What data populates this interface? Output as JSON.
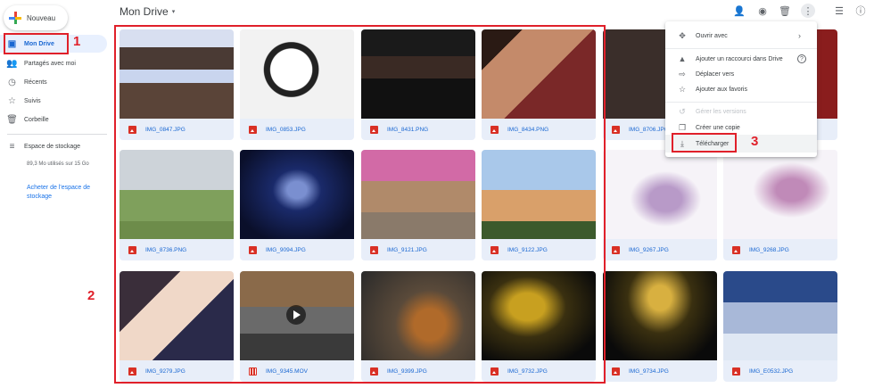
{
  "sidebar": {
    "new_label": "Nouveau",
    "items": [
      {
        "label": "Mon Drive",
        "icon": "my-drive-icon",
        "glyph": "▣"
      },
      {
        "label": "Partagés avec moi",
        "icon": "shared-icon",
        "glyph": "👥"
      },
      {
        "label": "Récents",
        "icon": "clock-icon",
        "glyph": "◷"
      },
      {
        "label": "Suivis",
        "icon": "star-icon",
        "glyph": "☆"
      },
      {
        "label": "Corbeille",
        "icon": "trash-icon",
        "glyph": "🗑"
      }
    ],
    "storage_label": "Espace de stockage",
    "storage_icon": "storage-icon",
    "storage_used": "89,3 Mo utilisés sur 15 Go",
    "buy_storage": "Acheter de l'espace de stockage"
  },
  "header": {
    "title": "Mon Drive",
    "caret": "▾",
    "icons": [
      {
        "name": "add-person-icon",
        "glyph": "👤"
      },
      {
        "name": "eye-icon",
        "glyph": "◉"
      },
      {
        "name": "trash-icon",
        "glyph": "🗑"
      },
      {
        "name": "more-vert-icon",
        "glyph": "⋮"
      },
      {
        "name": "list-view-icon",
        "glyph": "☰"
      },
      {
        "name": "info-icon",
        "glyph": "ⓘ"
      }
    ]
  },
  "files": [
    {
      "name": "IMG_0847.JPG",
      "type": "image"
    },
    {
      "name": "IMG_0853.JPG",
      "type": "image"
    },
    {
      "name": "IMG_8431.PNG",
      "type": "image"
    },
    {
      "name": "IMG_8434.PNG",
      "type": "image"
    },
    {
      "name": "IMG_8706.JPG",
      "type": "image"
    },
    {
      "name": "",
      "type": "image"
    },
    {
      "name": "IMG_8736.PNG",
      "type": "image"
    },
    {
      "name": "IMG_9094.JPG",
      "type": "image"
    },
    {
      "name": "IMG_9121.JPG",
      "type": "image"
    },
    {
      "name": "IMG_9122.JPG",
      "type": "image"
    },
    {
      "name": "IMG_9267.JPG",
      "type": "image"
    },
    {
      "name": "IMG_9268.JPG",
      "type": "image"
    },
    {
      "name": "IMG_9279.JPG",
      "type": "image"
    },
    {
      "name": "IMG_9345.MOV",
      "type": "video"
    },
    {
      "name": "IMG_9399.JPG",
      "type": "image"
    },
    {
      "name": "IMG_9732.JPG",
      "type": "image"
    },
    {
      "name": "IMG_9734.JPG",
      "type": "image"
    },
    {
      "name": "IMG_E0532.JPG",
      "type": "image"
    }
  ],
  "menu": {
    "items": [
      {
        "label": "Ouvrir avec",
        "icon": "open-with-icon",
        "glyph": "✥",
        "disabled": false
      },
      {
        "label": "Ajouter un raccourci dans Drive",
        "icon": "drive-shortcut-icon",
        "glyph": "▲",
        "disabled": false
      },
      {
        "label": "Déplacer vers",
        "icon": "move-to-icon",
        "glyph": "⇨",
        "disabled": false
      },
      {
        "label": "Ajouter aux favoris",
        "icon": "star-icon",
        "glyph": "☆",
        "disabled": false
      },
      {
        "label": "Gérer les versions",
        "icon": "history-icon",
        "glyph": "↺",
        "disabled": true
      },
      {
        "label": "Créer une copie",
        "icon": "copy-icon",
        "glyph": "❐",
        "disabled": false
      },
      {
        "label": "Télécharger",
        "icon": "download-icon",
        "glyph": "⤓",
        "disabled": false
      }
    ],
    "submenu_arrow": "›",
    "help_glyph": "?"
  },
  "annotations": [
    "1",
    "2",
    "3"
  ],
  "colors": {
    "accent": "#1a73e8",
    "active_bg": "#e8f0fe",
    "annotation": "#e0202a",
    "card_bg": "#e8eef9"
  }
}
